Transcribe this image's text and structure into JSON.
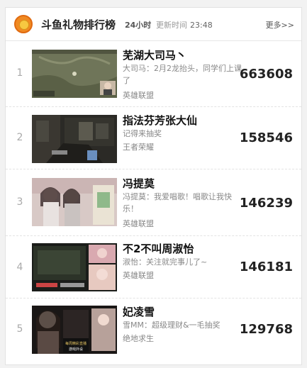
{
  "header": {
    "title": "斗鱼礼物排行榜",
    "period": "24小时",
    "update_label": "更新时间",
    "update_time": "23:48",
    "more": "更多>>"
  },
  "items": [
    {
      "rank": "1",
      "name": "芜湖大司马丶",
      "desc": "大司马：2月2龙抬头，同学们上课了",
      "category": "英雄联盟",
      "score": "663608"
    },
    {
      "rank": "2",
      "name": "指法芬芳张大仙",
      "desc": "记得来抽奖",
      "category": "王者荣耀",
      "score": "158546"
    },
    {
      "rank": "3",
      "name": "冯提莫",
      "desc": "冯提莫：我爱唱歌！唱歌让我快乐！",
      "category": "英雄联盟",
      "score": "146239"
    },
    {
      "rank": "4",
      "name": "不2不叫周淑怡",
      "desc": "淑怡：关注就完事儿了~",
      "category": "英雄联盟",
      "score": "146181"
    },
    {
      "rank": "5",
      "name": "妃凌雪",
      "desc": "雪MM：超级理财&一毛抽奖",
      "category": "绝地求生",
      "score": "129768"
    }
  ],
  "thumb_text": {
    "t5_line1": "每周精彩直播",
    "t5_line2": "游戏外设"
  }
}
